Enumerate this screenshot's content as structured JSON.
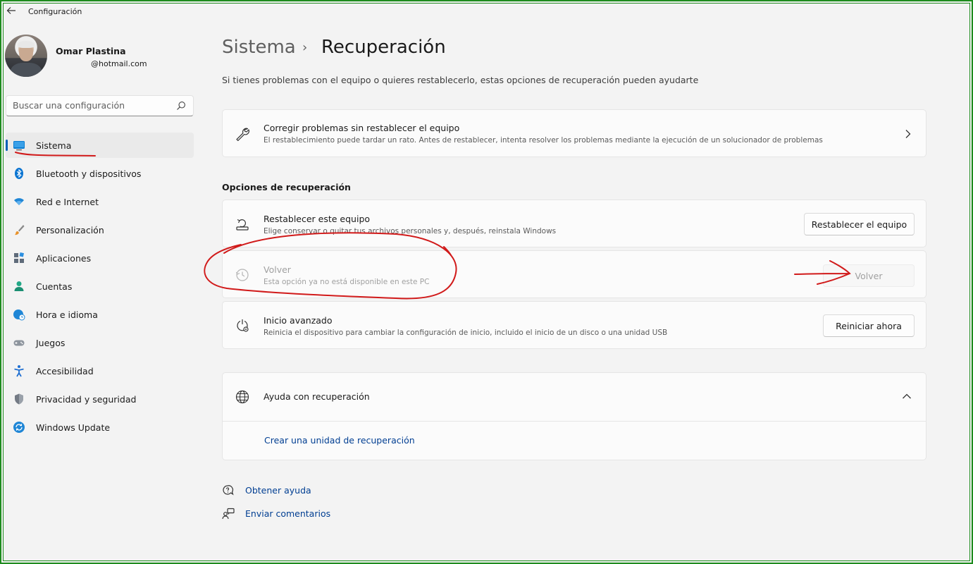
{
  "window": {
    "title": "Configuración"
  },
  "profile": {
    "name": "Omar Plastina",
    "email": "@hotmail.com"
  },
  "search": {
    "placeholder": "Buscar una configuración"
  },
  "nav": {
    "items": [
      {
        "label": "Sistema",
        "icon": "monitor-icon",
        "active": true
      },
      {
        "label": "Bluetooth y dispositivos",
        "icon": "bluetooth-icon"
      },
      {
        "label": "Red e Internet",
        "icon": "wifi-icon"
      },
      {
        "label": "Personalización",
        "icon": "brush-icon"
      },
      {
        "label": "Aplicaciones",
        "icon": "apps-icon"
      },
      {
        "label": "Cuentas",
        "icon": "person-icon"
      },
      {
        "label": "Hora e idioma",
        "icon": "globe-clock-icon"
      },
      {
        "label": "Juegos",
        "icon": "gamepad-icon"
      },
      {
        "label": "Accesibilidad",
        "icon": "accessibility-icon"
      },
      {
        "label": "Privacidad y seguridad",
        "icon": "shield-icon"
      },
      {
        "label": "Windows Update",
        "icon": "update-icon"
      }
    ]
  },
  "page": {
    "breadcrumb_parent": "Sistema",
    "breadcrumb_separator": "›",
    "title": "Recuperación",
    "subtitle": "Si tienes problemas con el equipo o quieres restablecerlo, estas opciones de recuperación pueden ayudarte"
  },
  "fix_card": {
    "title": "Corregir problemas sin restablecer el equipo",
    "description": "El restablecimiento puede tardar un rato. Antes de restablecer, intenta resolver los problemas mediante la ejecución de un solucionador de problemas"
  },
  "recovery_options": {
    "heading": "Opciones de recuperación",
    "reset": {
      "title": "Restablecer este equipo",
      "description": "Elige conservar o quitar tus archivos personales y, después, reinstala Windows",
      "button": "Restablecer el equipo"
    },
    "go_back": {
      "title": "Volver",
      "description": "Esta opción ya no está disponible en este PC",
      "button": "Volver",
      "disabled": true
    },
    "advanced": {
      "title": "Inicio avanzado",
      "description": "Reinicia el dispositivo para cambiar la configuración de inicio, incluido el inicio de un disco o una unidad USB",
      "button": "Reiniciar ahora"
    }
  },
  "help": {
    "title": "Ayuda con recuperación",
    "link": "Crear una unidad de recuperación"
  },
  "footer": {
    "get_help": "Obtener ayuda",
    "feedback": "Enviar comentarios"
  },
  "colors": {
    "accent": "#005fb8",
    "annotation": "#d11a1a",
    "frame": "#1d8b1d"
  }
}
